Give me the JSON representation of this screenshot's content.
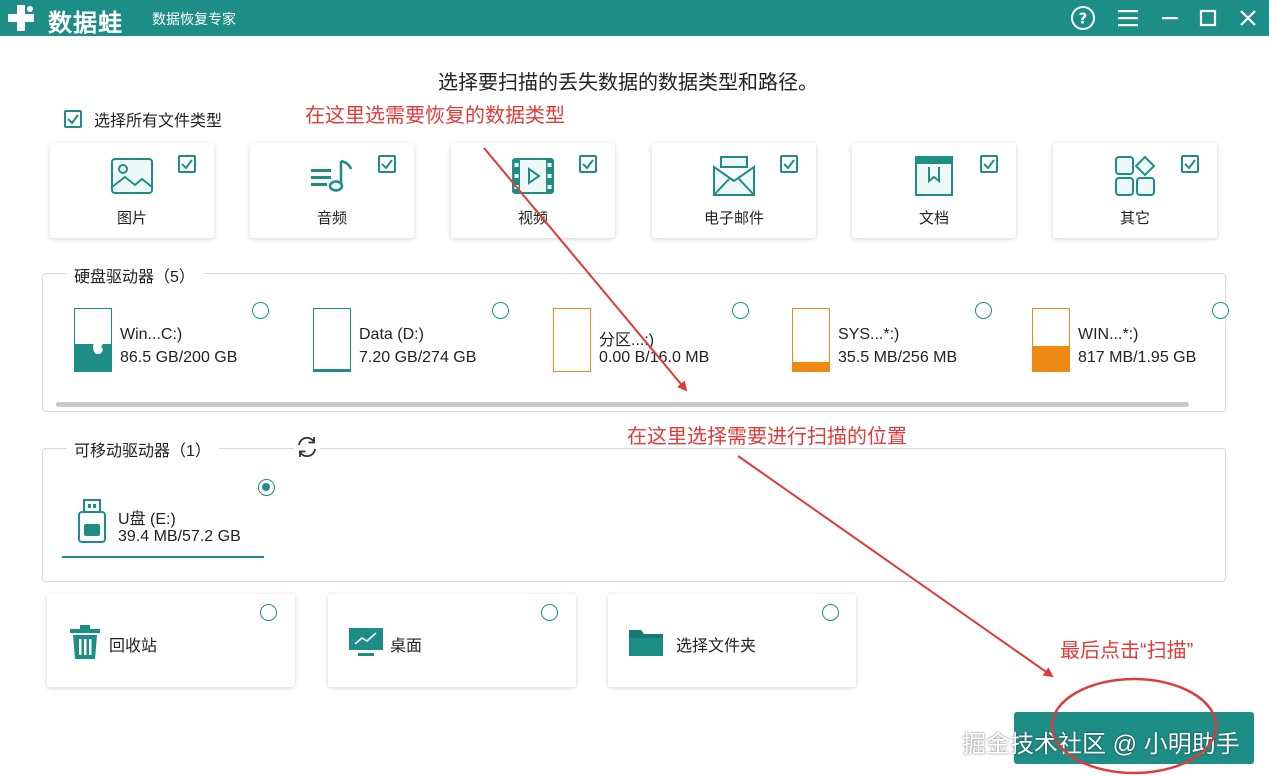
{
  "titlebar": {
    "brand": "数据蛙",
    "subtitle": "数据恢复专家"
  },
  "main_title": "选择要扫描的丢失数据的数据类型和路径。",
  "select_all": {
    "label": "选择所有文件类型",
    "checked": true
  },
  "annotations": {
    "types": "在这里选需要恢复的数据类型",
    "location": "在这里选择需要进行扫描的位置",
    "scan": "最后点击“扫描”"
  },
  "file_types": [
    {
      "label": "图片",
      "icon": "image-icon",
      "checked": true
    },
    {
      "label": "音频",
      "icon": "music-icon",
      "checked": true
    },
    {
      "label": "视频",
      "icon": "video-icon",
      "checked": true
    },
    {
      "label": "电子邮件",
      "icon": "mail-icon",
      "checked": true
    },
    {
      "label": "文档",
      "icon": "document-icon",
      "checked": true
    },
    {
      "label": "其它",
      "icon": "other-icon",
      "checked": true
    }
  ],
  "hard_drives": {
    "title": "硬盘驱动器（5）",
    "items": [
      {
        "name": "Win...C:)",
        "size": "86.5 GB/200 GB",
        "used_fraction": 0.43,
        "color": "#1d8e86",
        "os_badge": "apple-icon"
      },
      {
        "name": "Data (D:)",
        "size": "7.20 GB/274 GB",
        "used_fraction": 0.03,
        "color": "#1d8e86"
      },
      {
        "name": "分区...:)",
        "size": "0.00  B/16.0 MB",
        "used_fraction": 0.0,
        "color": "#ee8a14"
      },
      {
        "name": "SYS...*:)",
        "size": "35.5 MB/256 MB",
        "used_fraction": 0.14,
        "color": "#ee8a14"
      },
      {
        "name": "WIN...*:)",
        "size": "817 MB/1.95 GB",
        "used_fraction": 0.41,
        "color": "#ee8a14"
      }
    ]
  },
  "removable_drives": {
    "title": "可移动驱动器（1）",
    "items": [
      {
        "name": "U盘 (E:)",
        "size": "39.4 MB/57.2 GB",
        "selected": true
      }
    ]
  },
  "locations": [
    {
      "label": "回收站",
      "icon": "recycle-bin-icon"
    },
    {
      "label": "桌面",
      "icon": "desktop-icon"
    },
    {
      "label": "选择文件夹",
      "icon": "folder-icon"
    }
  ],
  "watermark": "掘金技术社区 @ 小明助手",
  "colors": {
    "accent": "#1d8e86",
    "annotation": "#e03b3b",
    "partition": "#ee8a14"
  }
}
